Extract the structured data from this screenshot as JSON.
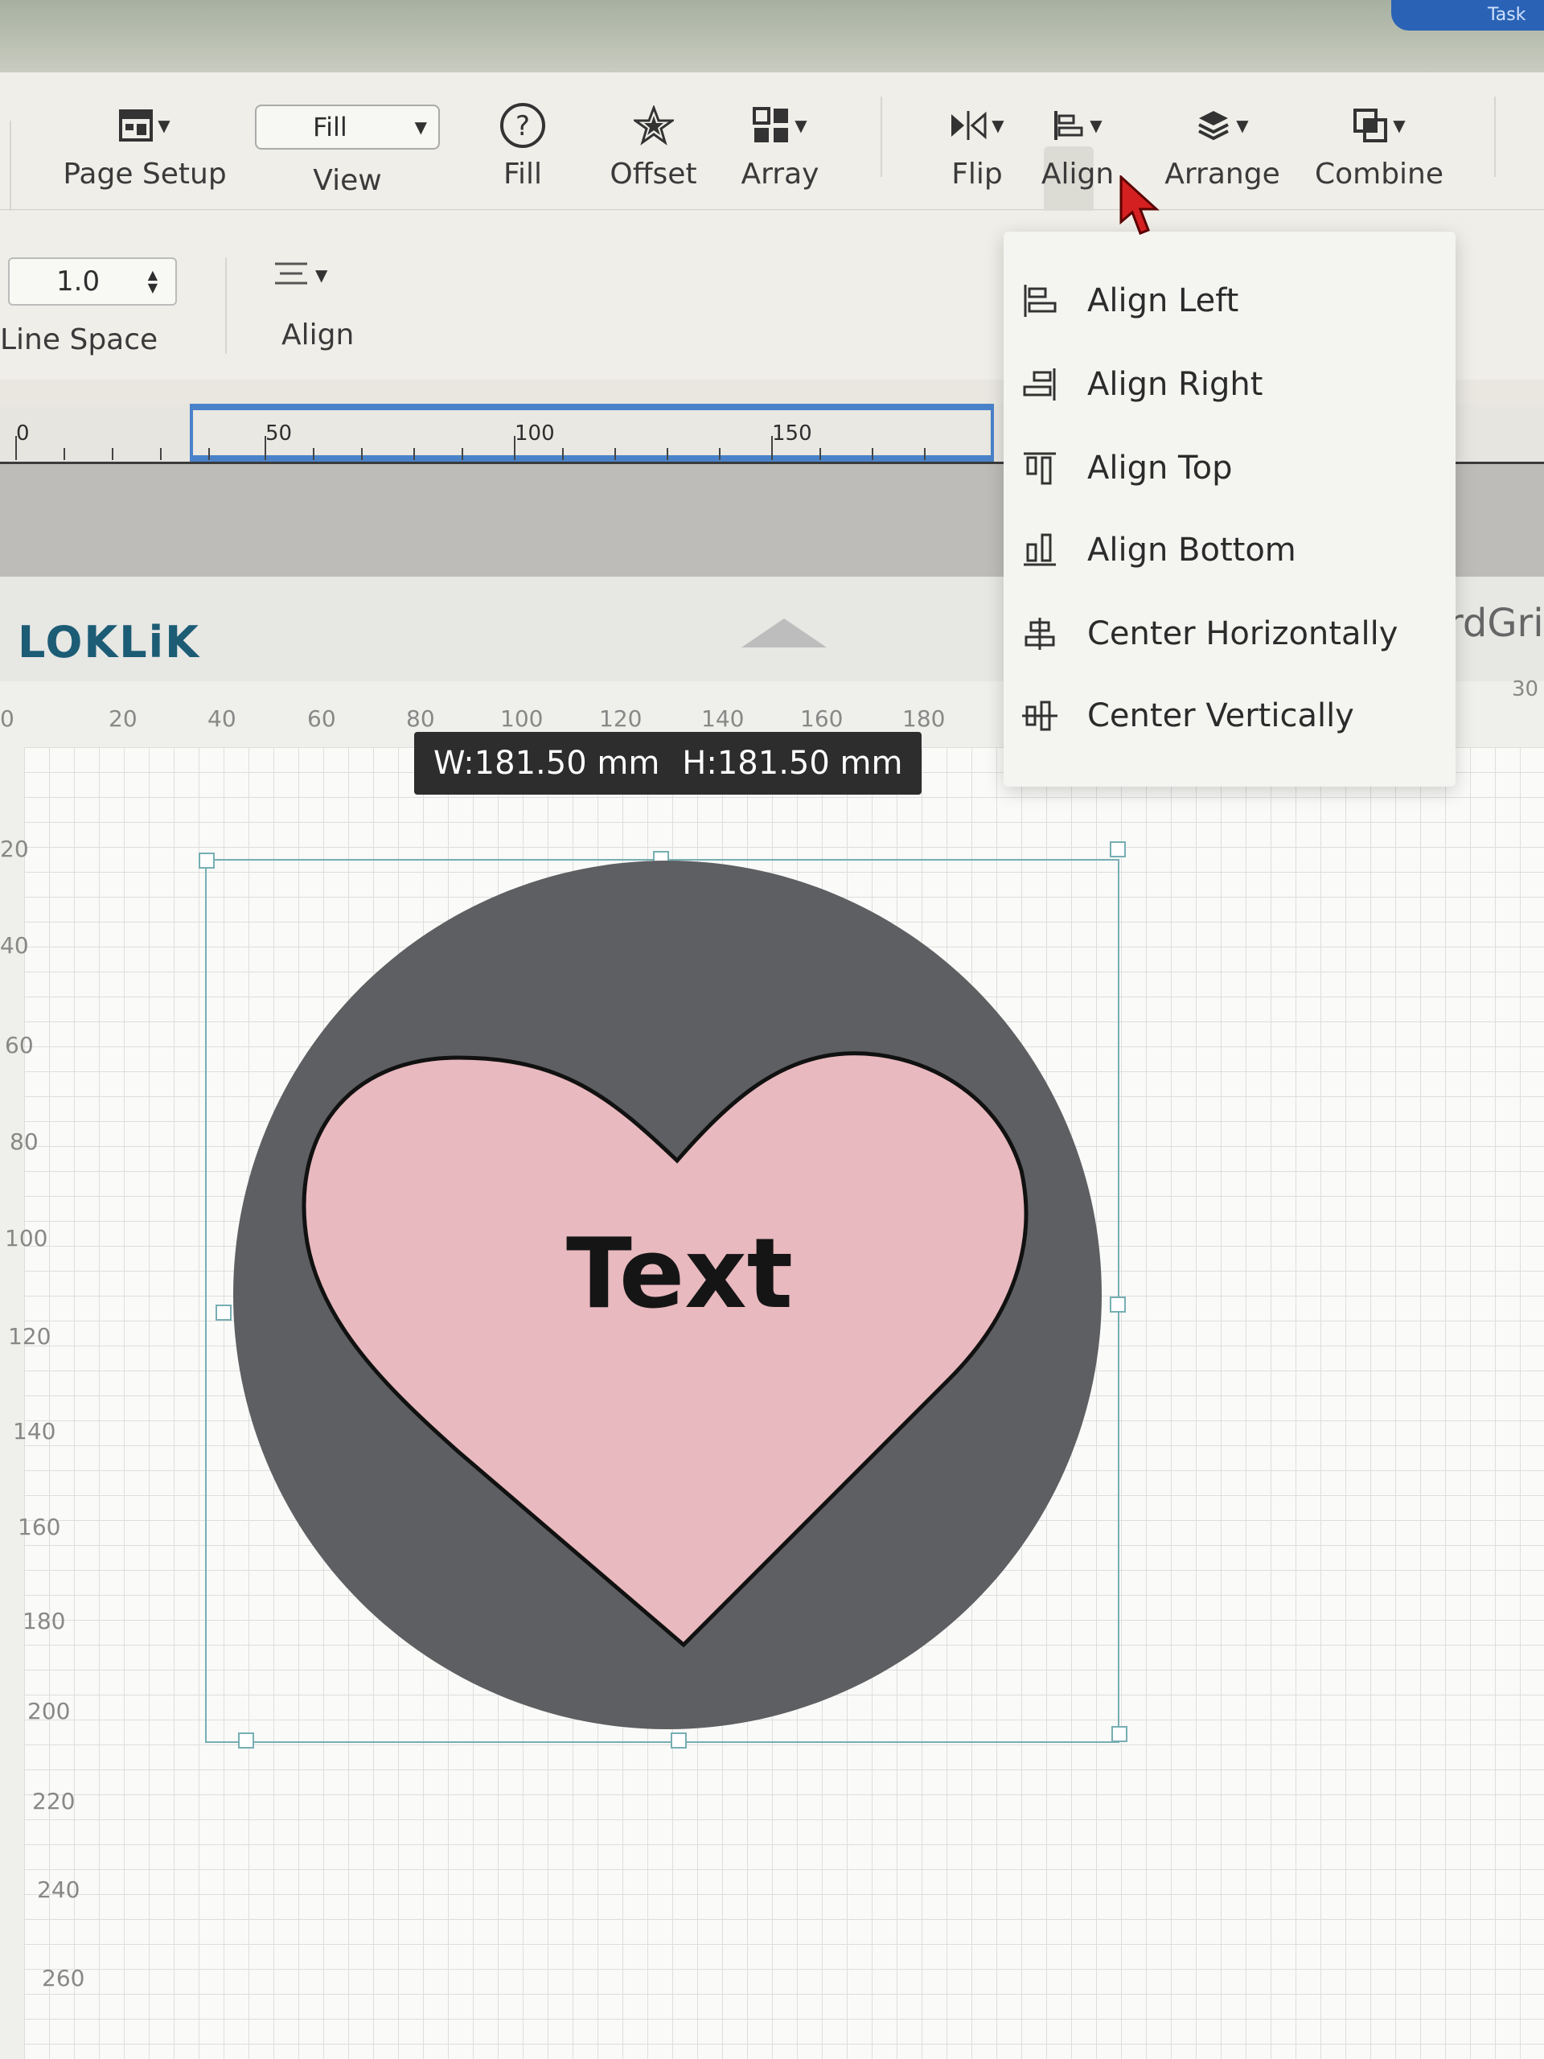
{
  "topbar": {
    "corner_label": "Task"
  },
  "toolbar": {
    "page_setup": "Page Setup",
    "view_value": "Fill",
    "view_label": "View",
    "fill": "Fill",
    "offset": "Offset",
    "array": "Array",
    "flip": "Flip",
    "align": "Align",
    "arrange": "Arrange",
    "combine": "Combine"
  },
  "text_options": {
    "line_space_value": "1.0",
    "line_space_label": "Line Space",
    "align_label": "Align"
  },
  "ruler_top": {
    "ticks": [
      "0",
      "50",
      "100",
      "150"
    ]
  },
  "brand": {
    "logo": "LOKLiK",
    "partial_text": "rdGri",
    "right_num": "30"
  },
  "canvas": {
    "h_ticks": [
      "0",
      "20",
      "40",
      "60",
      "80",
      "100",
      "120",
      "140",
      "160",
      "180"
    ],
    "v_ticks": [
      "20",
      "40",
      "60",
      "80",
      "100",
      "120",
      "140",
      "160",
      "180",
      "200",
      "220",
      "240",
      "260"
    ],
    "size_tooltip": {
      "width": "W:181.50 mm",
      "height": "H:181.50 mm"
    },
    "shape_text": "Text",
    "colors": {
      "circle": "#5e5f62",
      "heart": "#e8b9be"
    }
  },
  "align_menu": {
    "items": [
      {
        "label": "Align Left",
        "icon": "align-left-icon"
      },
      {
        "label": "Align Right",
        "icon": "align-right-icon"
      },
      {
        "label": "Align Top",
        "icon": "align-top-icon"
      },
      {
        "label": "Align Bottom",
        "icon": "align-bottom-icon"
      },
      {
        "label": "Center Horizontally",
        "icon": "center-horizontally-icon"
      },
      {
        "label": "Center Vertically",
        "icon": "center-vertically-icon"
      }
    ]
  }
}
